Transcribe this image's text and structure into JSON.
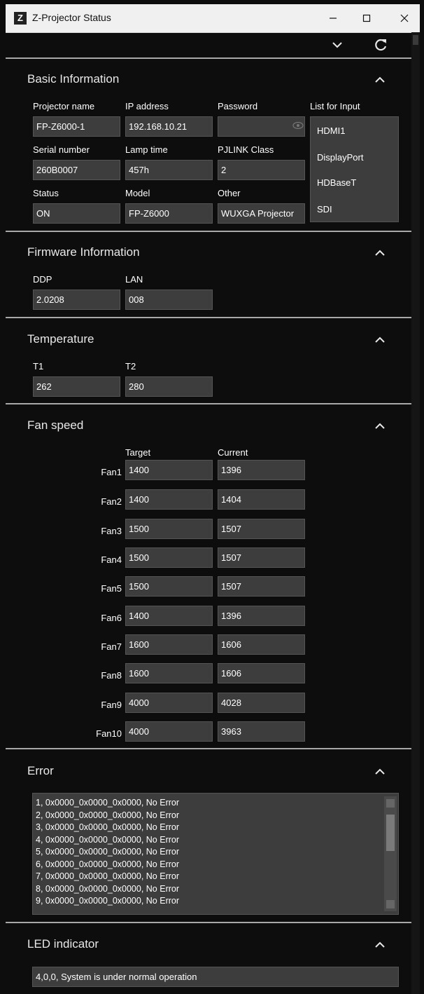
{
  "window": {
    "title": "Z-Projector Status",
    "app_icon": "Z",
    "minimize_icon": "minimize-icon",
    "maximize_icon": "maximize-icon",
    "close_icon": "close-icon"
  },
  "toolbar": {
    "dropdown_icon": "chevron-down-icon",
    "refresh_icon": "refresh-icon"
  },
  "basic": {
    "title": "Basic Information",
    "projector_name_label": "Projector name",
    "projector_name": "FP-Z6000-1",
    "ip_label": "IP address",
    "ip": "192.168.10.21",
    "password_label": "Password",
    "password": "",
    "list_label": "List for Input",
    "inputs": [
      "HDMI1",
      "DisplayPort",
      "HDBaseT",
      "SDI"
    ],
    "serial_label": "Serial number",
    "serial": "260B0007",
    "lamp_label": "Lamp time",
    "lamp": "457h",
    "pjlink_label": "PJLINK Class",
    "pjlink": "2",
    "status_label": "Status",
    "status": "ON",
    "model_label": "Model",
    "model": "FP-Z6000",
    "other_label": "Other",
    "other": "WUXGA Projector"
  },
  "firmware": {
    "title": "Firmware Information",
    "ddp_label": "DDP",
    "ddp": "2.0208",
    "lan_label": "LAN",
    "lan": "008"
  },
  "temperature": {
    "title": "Temperature",
    "t1_label": "T1",
    "t1": "262",
    "t2_label": "T2",
    "t2": "280"
  },
  "fans": {
    "title": "Fan speed",
    "target_label": "Target",
    "current_label": "Current",
    "rows": [
      {
        "name": "Fan1",
        "target": "1400",
        "current": "1396"
      },
      {
        "name": "Fan2",
        "target": "1400",
        "current": "1404"
      },
      {
        "name": "Fan3",
        "target": "1500",
        "current": "1507"
      },
      {
        "name": "Fan4",
        "target": "1500",
        "current": "1507"
      },
      {
        "name": "Fan5",
        "target": "1500",
        "current": "1507"
      },
      {
        "name": "Fan6",
        "target": "1400",
        "current": "1396"
      },
      {
        "name": "Fan7",
        "target": "1600",
        "current": "1606"
      },
      {
        "name": "Fan8",
        "target": "1600",
        "current": "1606"
      },
      {
        "name": "Fan9",
        "target": "4000",
        "current": "4028"
      },
      {
        "name": "Fan10",
        "target": "4000",
        "current": "3963"
      }
    ]
  },
  "error": {
    "title": "Error",
    "lines": [
      "1, 0x0000_0x0000_0x0000, No Error",
      "2, 0x0000_0x0000_0x0000, No Error",
      "3, 0x0000_0x0000_0x0000, No Error",
      "4, 0x0000_0x0000_0x0000, No Error",
      "5, 0x0000_0x0000_0x0000, No Error",
      "6, 0x0000_0x0000_0x0000, No Error",
      "7, 0x0000_0x0000_0x0000, No Error",
      "8, 0x0000_0x0000_0x0000, No Error",
      "9, 0x0000_0x0000_0x0000, No Error"
    ]
  },
  "led": {
    "title": "LED indicator",
    "value": "4,0,0, System is under normal operation"
  },
  "colors": {
    "background": "#0d0d0d",
    "field": "#3d3d3d",
    "separator": "#a8a8a8",
    "titlebar": "#f0f0f0"
  }
}
